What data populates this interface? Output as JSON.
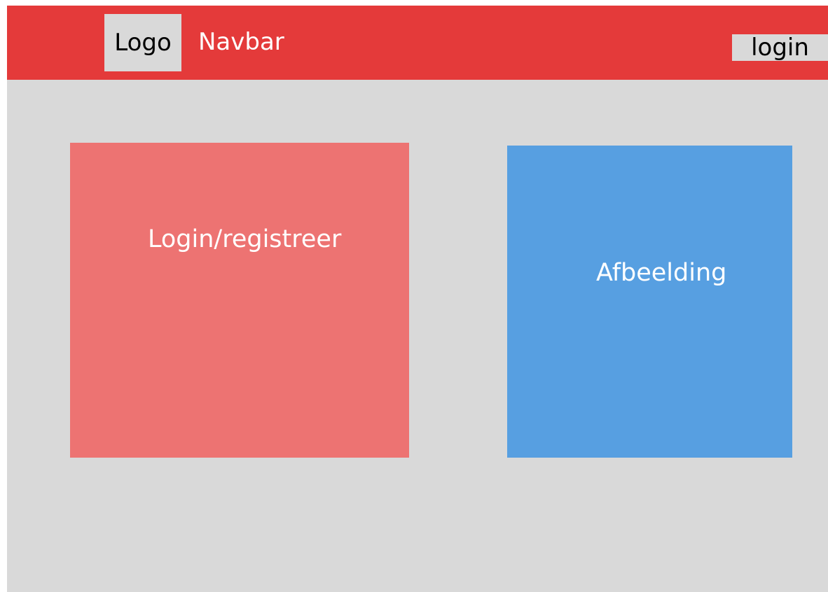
{
  "navbar": {
    "logo_label": "Logo",
    "title": "Navbar",
    "login_label": "login",
    "background_color": "#e43a3a"
  },
  "main": {
    "login_panel": {
      "label": "Login/registreer",
      "color": "#ed7372"
    },
    "image_panel": {
      "label": "Afbeelding",
      "color": "#579fe1"
    },
    "background_color": "#d9d9d9"
  }
}
